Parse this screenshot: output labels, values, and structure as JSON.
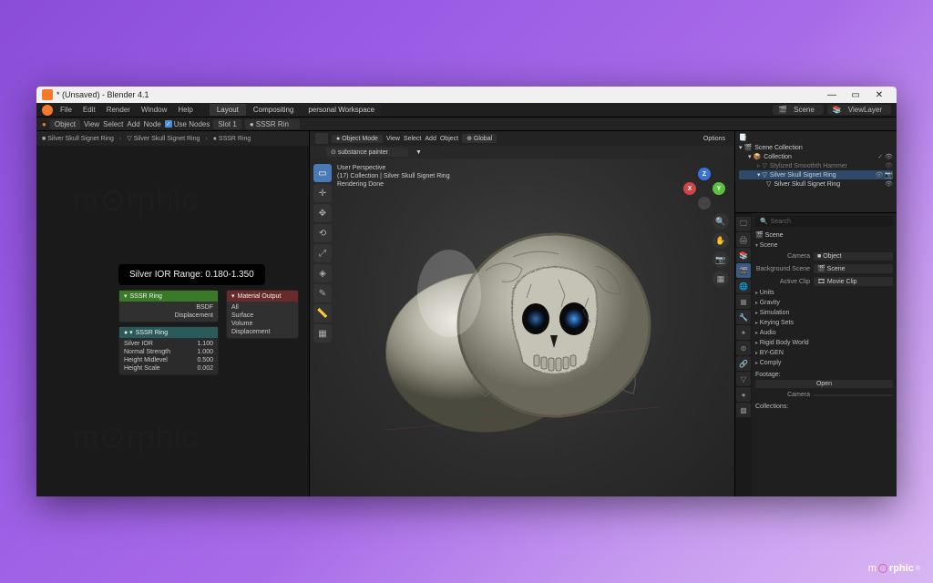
{
  "titlebar": {
    "title": "* (Unsaved) - Blender 4.1"
  },
  "menubar": {
    "items": [
      "File",
      "Edit",
      "Render",
      "Window",
      "Help"
    ],
    "tabs": [
      "Layout",
      "Compositing",
      "personal Workspace"
    ],
    "scene_label": "Scene",
    "viewlayer_label": "ViewLayer"
  },
  "node_toolbar": {
    "object_dd": "Object",
    "menus": [
      "View",
      "Select",
      "Add",
      "Node"
    ],
    "use_nodes": "Use Nodes",
    "slot": "Slot 1",
    "mat": "SSSR Rin"
  },
  "breadcrumb": {
    "a": "Silver Skull Signet Ring",
    "b": "Silver Skull Signet Ring",
    "c": "SSSR Ring"
  },
  "tooltip": "Silver IOR Range: 0.180-1.350",
  "node_group": {
    "title": "SSSR Ring",
    "out_a": "BSDF",
    "out_b": "Displacement",
    "mat_out_title": "Material Output",
    "mo_all": "All",
    "mo_surf": "Surface",
    "mo_vol": "Volume",
    "mo_disp": "Displacement",
    "props_title": "SSSR Ring",
    "p1k": "Silver IOR",
    "p1v": "1.100",
    "p2k": "Normal Strength",
    "p2v": "1.000",
    "p3k": "Height Midlevel",
    "p3v": "0.500",
    "p4k": "Height Scale",
    "p4v": "0.002"
  },
  "viewport": {
    "mode": "Object Mode",
    "menus": [
      "View",
      "Select",
      "Add",
      "Object"
    ],
    "global": "Global",
    "substance": "substance painter",
    "info1": "User Perspective",
    "info2": "(17) Collection | Silver Skull Signet Ring",
    "info3": "Rendering Done",
    "options": "Options"
  },
  "outliner": {
    "root": "Scene Collection",
    "coll": "Collection",
    "item1": "Stylized Smoothth Hammer",
    "item2": "Silver Skull Signet Ring",
    "item3": "Silver Skull Signet Ring"
  },
  "props": {
    "search_ph": "Search",
    "scene_hdr": "Scene",
    "scene_hdr2": "Scene",
    "camera_k": "Camera",
    "camera_v": "Object",
    "bg_k": "Background Scene",
    "bg_v": "Scene",
    "clip_k": "Active Clip",
    "clip_v": "Movie Clip",
    "sec_units": "Units",
    "sec_gravity": "Gravity",
    "sec_sim": "Simulation",
    "sec_key": "Keying Sets",
    "sec_audio": "Audio",
    "sec_rigid": "Rigid Body World",
    "sec_bygen": "BY-GEN",
    "sec_comp": "Comply",
    "footage": "Footage:",
    "open": "Open",
    "camera2": "Camera",
    "collections": "Collections:"
  },
  "logo": {
    "a": "m",
    "b": "rphic"
  }
}
